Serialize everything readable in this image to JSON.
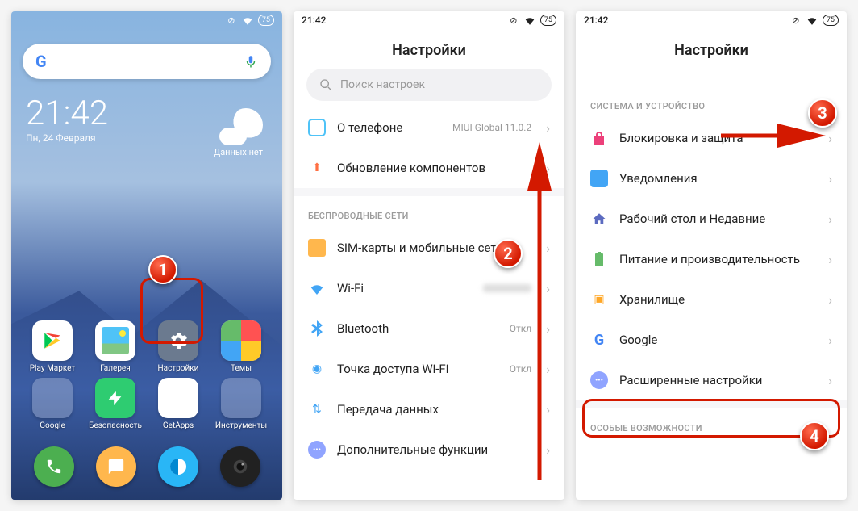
{
  "status": {
    "time": "21:42",
    "battery": "75"
  },
  "home": {
    "clock_time": "21:42",
    "clock_date": "Пн, 24 Февраля",
    "weather_text": "Данных нет",
    "apps": {
      "play": "Play Маркет",
      "gallery": "Галерея",
      "settings": "Настройки",
      "themes": "Темы",
      "google": "Google",
      "security": "Безопасность",
      "getapps": "GetApps",
      "tools": "Инструменты"
    }
  },
  "screen2": {
    "title": "Настройки",
    "search_placeholder": "Поиск настроек",
    "about_label": "О телефоне",
    "about_value": "MIUI Global 11.0.2",
    "update_label": "Обновление компонентов",
    "section_wireless": "БЕСПРОВОДНЫЕ СЕТИ",
    "sim_label": "SIM-карты и мобильные сети",
    "wifi_label": "Wi-Fi",
    "bt_label": "Bluetooth",
    "bt_value": "Откл",
    "hotspot_label": "Точка доступа Wi-Fi",
    "hotspot_value": "Откл",
    "data_label": "Передача данных",
    "more_label": "Дополнительные функции"
  },
  "screen3": {
    "title": "Настройки",
    "section_system": "СИСТЕМА И УСТРОЙСТВО",
    "lock_label": "Блокировка и защита",
    "notif_label": "Уведомления",
    "desktop_label": "Рабочий стол и Недавние",
    "power_label": "Питание и производительность",
    "storage_label": "Хранилище",
    "google_label": "Google",
    "advanced_label": "Расширенные настройки",
    "section_special": "ОСОБЫЕ ВОЗМОЖНОСТИ"
  }
}
